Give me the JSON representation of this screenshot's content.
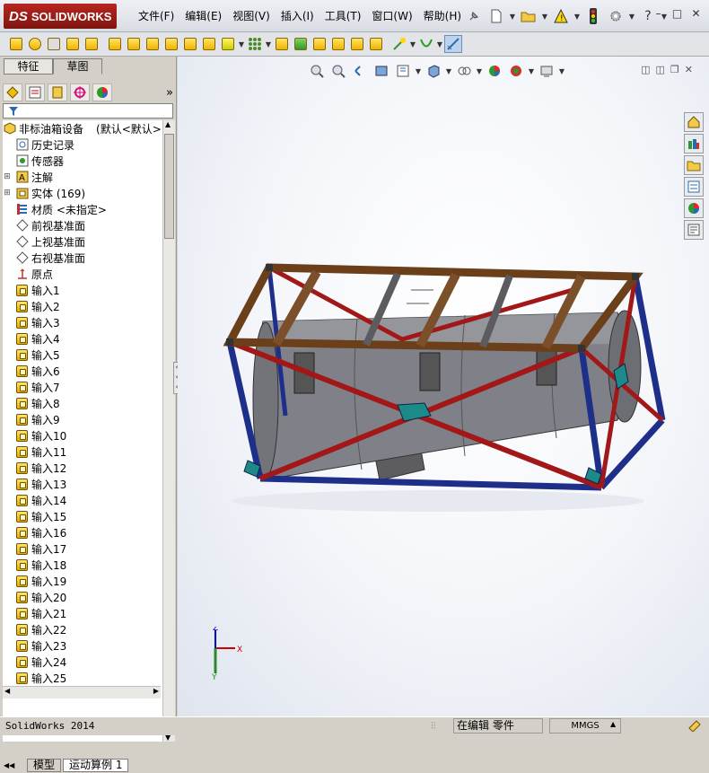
{
  "app": {
    "logo_brand": "SOLIDWORKS",
    "logo_ds": "DS"
  },
  "menu": [
    "文件(F)",
    "编辑(E)",
    "视图(V)",
    "插入(I)",
    "工具(T)",
    "窗口(W)",
    "帮助(H)"
  ],
  "panel_tabs": [
    "特征",
    "草图"
  ],
  "tree": {
    "root_label": "非标油箱设备",
    "root_config": "(默认<默认>",
    "items": [
      {
        "label": "历史记录",
        "icon": "history-icon"
      },
      {
        "label": "传感器",
        "icon": "sensor-icon"
      },
      {
        "label": "注解",
        "icon": "annotation-icon",
        "expandable": true
      },
      {
        "label": "实体 (169)",
        "icon": "solid-bodies-icon",
        "expandable": true
      },
      {
        "label": "材质 <未指定>",
        "icon": "material-icon"
      },
      {
        "label": "前视基准面",
        "icon": "plane-icon"
      },
      {
        "label": "上视基准面",
        "icon": "plane-icon"
      },
      {
        "label": "右视基准面",
        "icon": "plane-icon"
      },
      {
        "label": "原点",
        "icon": "origin-icon"
      }
    ],
    "inputs": [
      "输入1",
      "输入2",
      "输入3",
      "输入4",
      "输入5",
      "输入6",
      "输入7",
      "输入8",
      "输入9",
      "输入10",
      "输入11",
      "输入12",
      "输入13",
      "输入14",
      "输入15",
      "输入16",
      "输入17",
      "输入18",
      "输入19",
      "输入20",
      "输入21",
      "输入22",
      "输入23",
      "输入24",
      "输入25"
    ]
  },
  "bottom_tabs": [
    "模型",
    "运动算例 1"
  ],
  "triad": {
    "x": "X",
    "y": "Y",
    "z": "Z"
  },
  "status": {
    "app": "SolidWorks 2014",
    "mode": "在编辑 零件",
    "units": "MMGS"
  }
}
